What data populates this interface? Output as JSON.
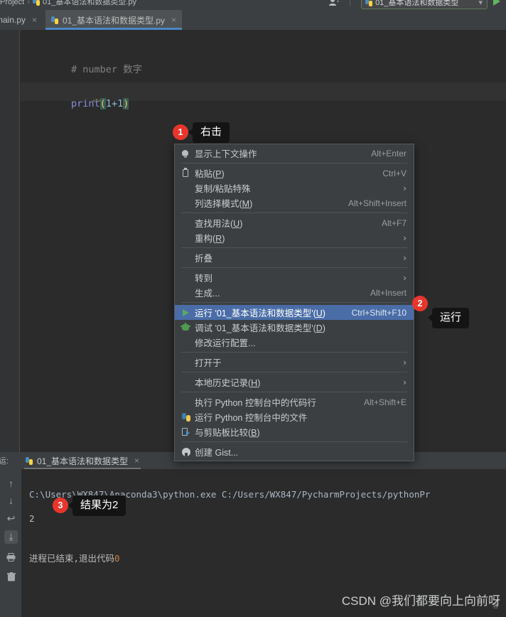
{
  "toolbar": {
    "nav_project": "Project",
    "nav_sep": "›",
    "nav_file": "01_基本语法和数据类型.py",
    "run_config": "01_基本语法和数据类型",
    "run_config_caret": "▾",
    "person_icon": "person-icon",
    "run_button_icon": "run-play-icon"
  },
  "editor_tabs": [
    {
      "label": "main.py",
      "close": "×",
      "active": false
    },
    {
      "label": "01_基本语法和数据类型.py",
      "close": "×",
      "active": true
    }
  ],
  "code": {
    "line1_comment": "# number 数字",
    "line2_func": "print",
    "line2_open": "(",
    "line2_expr": "1+1",
    "line2_close": ")"
  },
  "context_menu": {
    "items": [
      {
        "label": "显示上下文操作",
        "shortcut": "Alt+Enter",
        "icon": "lightbulb-icon",
        "arrow": "",
        "selected": false,
        "sep_after": true
      },
      {
        "label": "粘贴(P)",
        "underline": "P",
        "shortcut": "Ctrl+V",
        "icon": "clipboard-icon",
        "arrow": "",
        "selected": false
      },
      {
        "label": "复制/粘贴特殊",
        "shortcut": "",
        "icon": "",
        "arrow": "›",
        "selected": false
      },
      {
        "label": "列选择模式(M)",
        "underline": "M",
        "shortcut": "Alt+Shift+Insert",
        "icon": "",
        "arrow": "",
        "selected": false,
        "sep_after": true
      },
      {
        "label": "查找用法(U)",
        "underline": "U",
        "shortcut": "Alt+F7",
        "icon": "",
        "arrow": "",
        "selected": false
      },
      {
        "label": "重构(R)",
        "underline": "R",
        "shortcut": "",
        "icon": "",
        "arrow": "›",
        "selected": false,
        "sep_after": true
      },
      {
        "label": "折叠",
        "shortcut": "",
        "icon": "",
        "arrow": "›",
        "selected": false,
        "sep_after": true
      },
      {
        "label": "转到",
        "shortcut": "",
        "icon": "",
        "arrow": "›",
        "selected": false
      },
      {
        "label": "生成...",
        "shortcut": "Alt+Insert",
        "icon": "",
        "arrow": "",
        "selected": false,
        "sep_after": true
      },
      {
        "label": "运行 '01_基本语法和数据类型'(U)",
        "underline": "U",
        "shortcut": "Ctrl+Shift+F10",
        "icon": "run-play-icon",
        "arrow": "",
        "selected": true
      },
      {
        "label": "调试 '01_基本语法和数据类型'(D)",
        "underline": "D",
        "shortcut": "",
        "icon": "debug-bug-icon",
        "arrow": "",
        "selected": false
      },
      {
        "label": "修改运行配置...",
        "shortcut": "",
        "icon": "",
        "arrow": "",
        "selected": false,
        "sep_after": true
      },
      {
        "label": "打开于",
        "shortcut": "",
        "icon": "",
        "arrow": "›",
        "selected": false,
        "sep_after": true
      },
      {
        "label": "本地历史记录(H)",
        "underline": "H",
        "shortcut": "",
        "icon": "",
        "arrow": "›",
        "selected": false,
        "sep_after": true
      },
      {
        "label": "执行 Python 控制台中的代码行",
        "shortcut": "Alt+Shift+E",
        "icon": "",
        "arrow": "",
        "selected": false
      },
      {
        "label": "运行 Python 控制台中的文件",
        "shortcut": "",
        "icon": "python-icon",
        "arrow": "",
        "selected": false
      },
      {
        "label": "与剪贴板比较(B)",
        "underline": "B",
        "shortcut": "",
        "icon": "diff-icon",
        "arrow": "",
        "selected": false,
        "sep_after": true
      },
      {
        "label": "创建 Gist...",
        "shortcut": "",
        "icon": "github-icon",
        "arrow": "",
        "selected": false
      }
    ]
  },
  "annotations": [
    {
      "number": "1",
      "text": "右击"
    },
    {
      "number": "2",
      "text": "运行"
    },
    {
      "number": "3",
      "text": "结果为2"
    }
  ],
  "run_window": {
    "side_label": "运:",
    "tab_label": "01_基本语法和数据类型",
    "tab_close": "×",
    "toolbar_icons": [
      {
        "name": "up-arrow-icon",
        "glyph": "↑",
        "active": false
      },
      {
        "name": "down-arrow-icon",
        "glyph": "↓",
        "active": false
      },
      {
        "name": "soft-wrap-icon",
        "glyph": "↩",
        "active": false
      },
      {
        "name": "scroll-to-end-icon",
        "glyph": "⤓",
        "active": true
      },
      {
        "name": "print-icon",
        "glyph": "⎙",
        "active": false
      },
      {
        "name": "trash-icon",
        "glyph": "Ὕ1",
        "active": false
      }
    ],
    "console": {
      "command": "C:\\Users\\WX847\\Anaconda3\\python.exe C:/Users/WX847/PycharmProjects/pythonPr",
      "output": "2",
      "exit_text": "进程已结束,退出代码",
      "exit_code": "0"
    }
  },
  "watermark": {
    "text": "CSDN @我们都要向上向前呀",
    "sub": "客"
  },
  "colors": {
    "accent_blue": "#4a6da7",
    "tab_underline": "#4a88c7",
    "badge_red": "#e8362c",
    "editor_bg": "#2b2b2b",
    "chrome_bg": "#3c3f41",
    "menu_bg": "#3c3f41",
    "play_green": "#59a869"
  }
}
